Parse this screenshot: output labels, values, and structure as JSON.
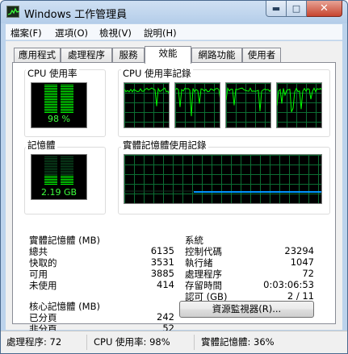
{
  "window": {
    "title": "Windows 工作管理員"
  },
  "menu": {
    "items": [
      "檔案(F)",
      "選項(O)",
      "檢視(V)",
      "說明(H)"
    ]
  },
  "tabs": [
    "應用程式",
    "處理程序",
    "服務",
    "效能",
    "網路功能",
    "使用者"
  ],
  "active_tab": "效能",
  "cpu": {
    "title": "CPU 使用率",
    "value_label": "98 %",
    "level_percent": 98,
    "history_title": "CPU 使用率記錄"
  },
  "memory": {
    "title": "記憶體",
    "value_label": "2.19 GB",
    "history_title": "實體記憶體使用記錄"
  },
  "physical_memory": {
    "title": "實體記憶體 (MB)",
    "rows": [
      {
        "label": "總共",
        "value": "6135"
      },
      {
        "label": "快取的",
        "value": "3531"
      },
      {
        "label": "可用",
        "value": "3885"
      },
      {
        "label": "未使用",
        "value": "414"
      }
    ]
  },
  "kernel_memory": {
    "title": "核心記憶體 (MB)",
    "rows": [
      {
        "label": "已分頁",
        "value": "242"
      },
      {
        "label": "非分頁",
        "value": "52"
      }
    ]
  },
  "system": {
    "title": "系統",
    "rows": [
      {
        "label": "控制代碼",
        "value": "23294"
      },
      {
        "label": "執行緒",
        "value": "1047"
      },
      {
        "label": "處理程序",
        "value": "72"
      },
      {
        "label": "存留時間",
        "value": "0:03:06:53"
      },
      {
        "label": "認可 (GB)",
        "value": "2 / 11"
      }
    ]
  },
  "resource_monitor_button": "資源監視器(R)...",
  "statusbar": {
    "processes": "處理程序: 72",
    "cpu": "CPU 使用率: 98%",
    "memory": "實體記憶體: 36%"
  },
  "colors": {
    "graph_green": "#00ff00",
    "memory_line": "#0094ff",
    "grid": "#0c6e33"
  }
}
